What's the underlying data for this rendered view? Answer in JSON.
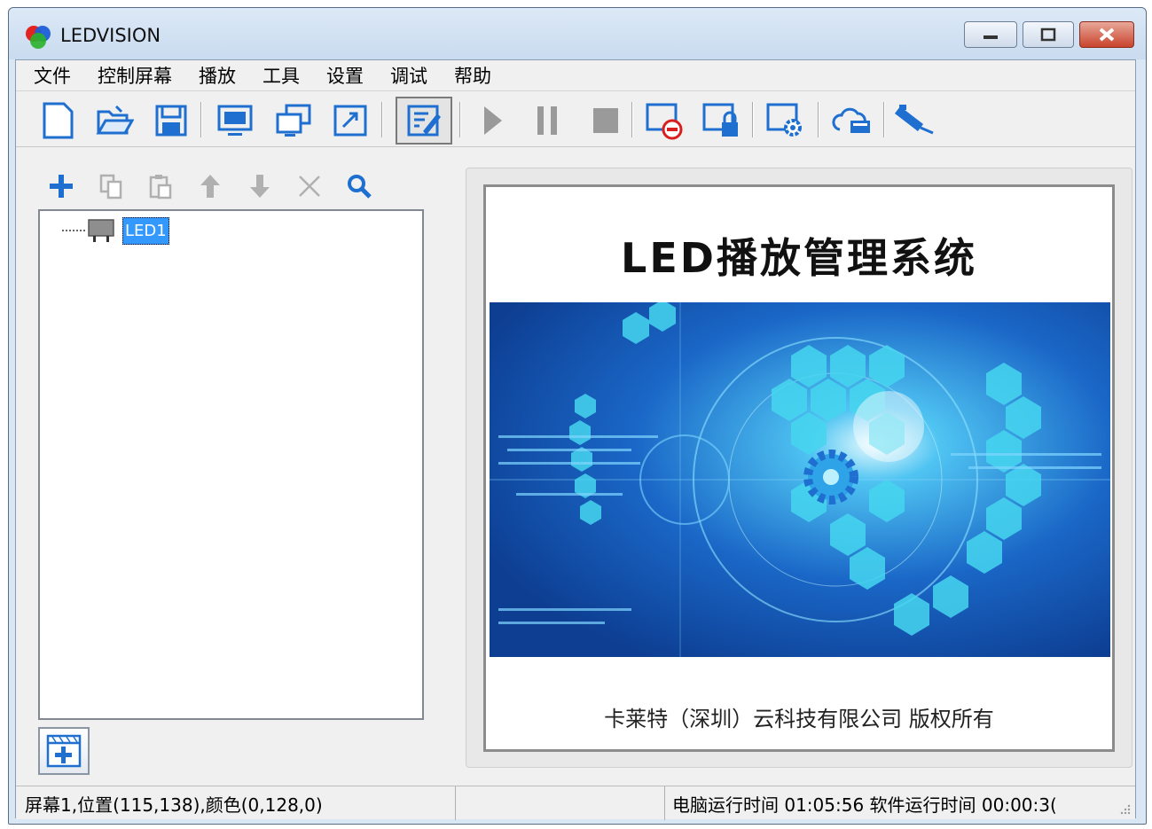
{
  "window": {
    "title": "LEDVISION"
  },
  "menu": [
    "文件",
    "控制屏幕",
    "播放",
    "工具",
    "设置",
    "调试",
    "帮助"
  ],
  "toolbar": {
    "icons": [
      "new-file-icon",
      "open-folder-icon",
      "save-icon",
      "screen-icon",
      "window-icon",
      "fullscreen-icon",
      "edit-icon",
      "play-icon",
      "pause-icon",
      "stop-icon",
      "screen-off-icon",
      "lock-screen-icon",
      "screen-settings-icon",
      "cloud-icon",
      "network-cable-icon"
    ]
  },
  "program_tools": {
    "icons": [
      "add-icon",
      "copy-icon",
      "paste-icon",
      "move-up-icon",
      "move-down-icon",
      "delete-icon",
      "search-icon"
    ]
  },
  "tree": {
    "node_label": "LED1"
  },
  "preview": {
    "title": "LED播放管理系统",
    "copyright": "卡莱特（深圳）云科技有限公司 版权所有"
  },
  "status": {
    "screen_info": "屏幕1,位置(115,138),颜色(0,128,0)",
    "middle": "",
    "runtime": "电脑运行时间 01:05:56 软件运行时间 00:00:3("
  },
  "colors": {
    "accent": "#1e6fd0",
    "selection": "#3399ff",
    "close_button": "#c9432c"
  }
}
